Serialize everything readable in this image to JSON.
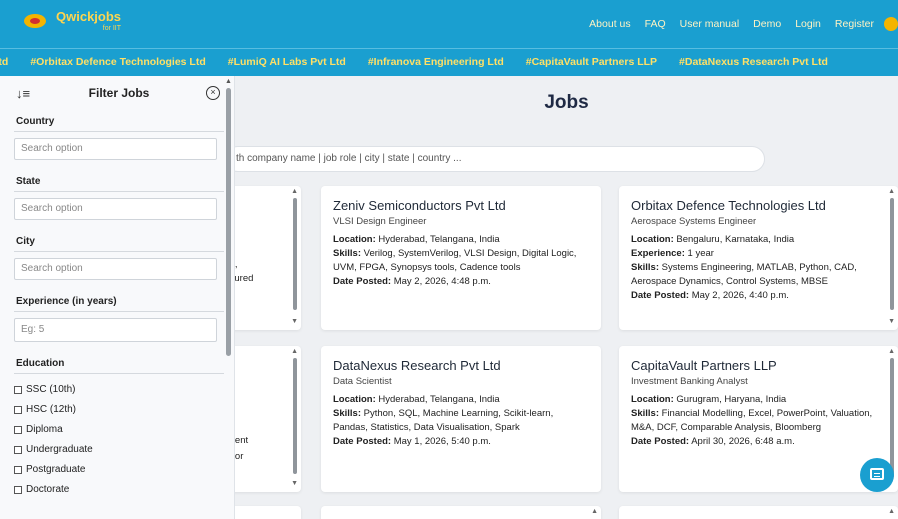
{
  "brand": {
    "name": "Qwickjobs",
    "tagline": "for IIT"
  },
  "nav": {
    "links": [
      "About us",
      "FAQ",
      "User manual",
      "Demo",
      "Login",
      "Register"
    ]
  },
  "ticker": [
    "Ltd",
    "#Orbitax Defence Technologies Ltd",
    "#LumiQ AI Labs Pvt Ltd",
    "#Infranova Engineering Ltd",
    "#CapitaVault Partners LLP",
    "#DataNexus Research Pvt Ltd"
  ],
  "sidebar": {
    "title": "Filter Jobs",
    "country": {
      "label": "Country",
      "placeholder": "Search option"
    },
    "state": {
      "label": "State",
      "placeholder": "Search option"
    },
    "city": {
      "label": "City",
      "placeholder": "Search option"
    },
    "experience": {
      "label": "Experience (in years)",
      "placeholder": "Eg: 5"
    },
    "education": {
      "label": "Education",
      "options": [
        "SSC (10th)",
        "HSC (12th)",
        "Diploma",
        "Undergraduate",
        "Postgraduate",
        "Doctorate"
      ]
    }
  },
  "main": {
    "title": "Jobs",
    "search_placeholder": "th company name | job role | city | state | country ..."
  },
  "labels": {
    "location": "Location:",
    "skills": "Skills:",
    "experience": "Experience:",
    "date_posted": "Date Posted:"
  },
  "partial_left": {
    "top": [
      "nt,",
      "ctured"
    ],
    "bottom": [
      "ment",
      "otor"
    ]
  },
  "jobs": [
    {
      "company": "Zeniv Semiconductors Pvt Ltd",
      "role": "VLSI Design Engineer",
      "location": "Hyderabad, Telangana, India",
      "skills": "Verilog, SystemVerilog, VLSI Design, Digital Logic, UVM, FPGA, Synopsys tools, Cadence tools",
      "date": "May 2, 2026, 4:48 p.m."
    },
    {
      "company": "Orbitax Defence Technologies Ltd",
      "role": "Aerospace Systems Engineer",
      "location": "Bengaluru, Karnataka, India",
      "experience": "1 year",
      "skills": "Systems Engineering, MATLAB, Python, CAD, Aerospace Dynamics, Control Systems, MBSE",
      "date": "May 2, 2026, 4:40 p.m."
    },
    {
      "company": "DataNexus Research Pvt Ltd",
      "role": "Data Scientist",
      "location": "Hyderabad, Telangana, India",
      "skills": "Python, SQL, Machine Learning, Scikit-learn, Pandas, Statistics, Data Visualisation, Spark",
      "date": "May 1, 2026, 5:40 p.m."
    },
    {
      "company": "CapitaVault Partners LLP",
      "role": "Investment Banking Analyst",
      "location": "Gurugram, Haryana, India",
      "skills": "Financial Modelling, Excel, PowerPoint, Valuation, M&A, DCF, Comparable Analysis, Bloomberg",
      "date": "April 30, 2026, 6:48 a.m."
    }
  ]
}
